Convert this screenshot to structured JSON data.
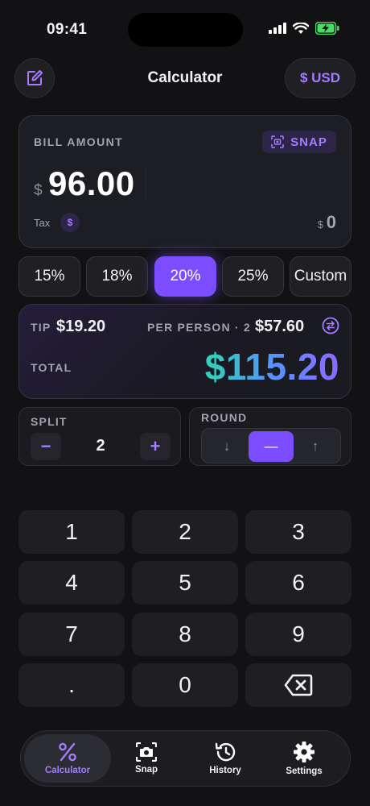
{
  "status_bar": {
    "time": "09:41"
  },
  "header": {
    "title": "Calculator",
    "currency_label": "$ USD"
  },
  "bill": {
    "label": "BILL AMOUNT",
    "snap_label": "SNAP",
    "currency_symbol": "$",
    "amount": "96.00",
    "tax_label": "Tax",
    "tax_badge": "$",
    "tax_currency": "$",
    "tax_value": "0"
  },
  "tip_options": [
    {
      "label": "15%",
      "active": false
    },
    {
      "label": "18%",
      "active": false
    },
    {
      "label": "20%",
      "active": true
    },
    {
      "label": "25%",
      "active": false
    },
    {
      "label": "Custom",
      "active": false
    }
  ],
  "summary": {
    "tip_label": "TIP",
    "tip_value": "$19.20",
    "per_person_label": "PER PERSON · 2",
    "per_person_value": "$57.60",
    "total_label": "TOTAL",
    "total_value": "$115.20"
  },
  "split": {
    "label": "SPLIT",
    "value": "2",
    "minus": "−",
    "plus": "+"
  },
  "round": {
    "label": "ROUND",
    "options": [
      "↓",
      "—",
      "↑"
    ],
    "selected_index": 1
  },
  "keypad": {
    "keys": [
      "1",
      "2",
      "3",
      "4",
      "5",
      "6",
      "7",
      "8",
      "9",
      ".",
      "0",
      "backspace"
    ]
  },
  "tabs": [
    {
      "label": "Calculator",
      "icon": "percent-icon",
      "active": true
    },
    {
      "label": "Snap",
      "icon": "camera-icon",
      "active": false
    },
    {
      "label": "History",
      "icon": "history-icon",
      "active": false
    },
    {
      "label": "Settings",
      "icon": "gear-icon",
      "active": false
    }
  ],
  "colors": {
    "accent": "#7c4dff",
    "accent_text": "#a57bff",
    "background": "#121214",
    "total_gradient": [
      "#2fd5b8",
      "#8a6bff"
    ]
  }
}
